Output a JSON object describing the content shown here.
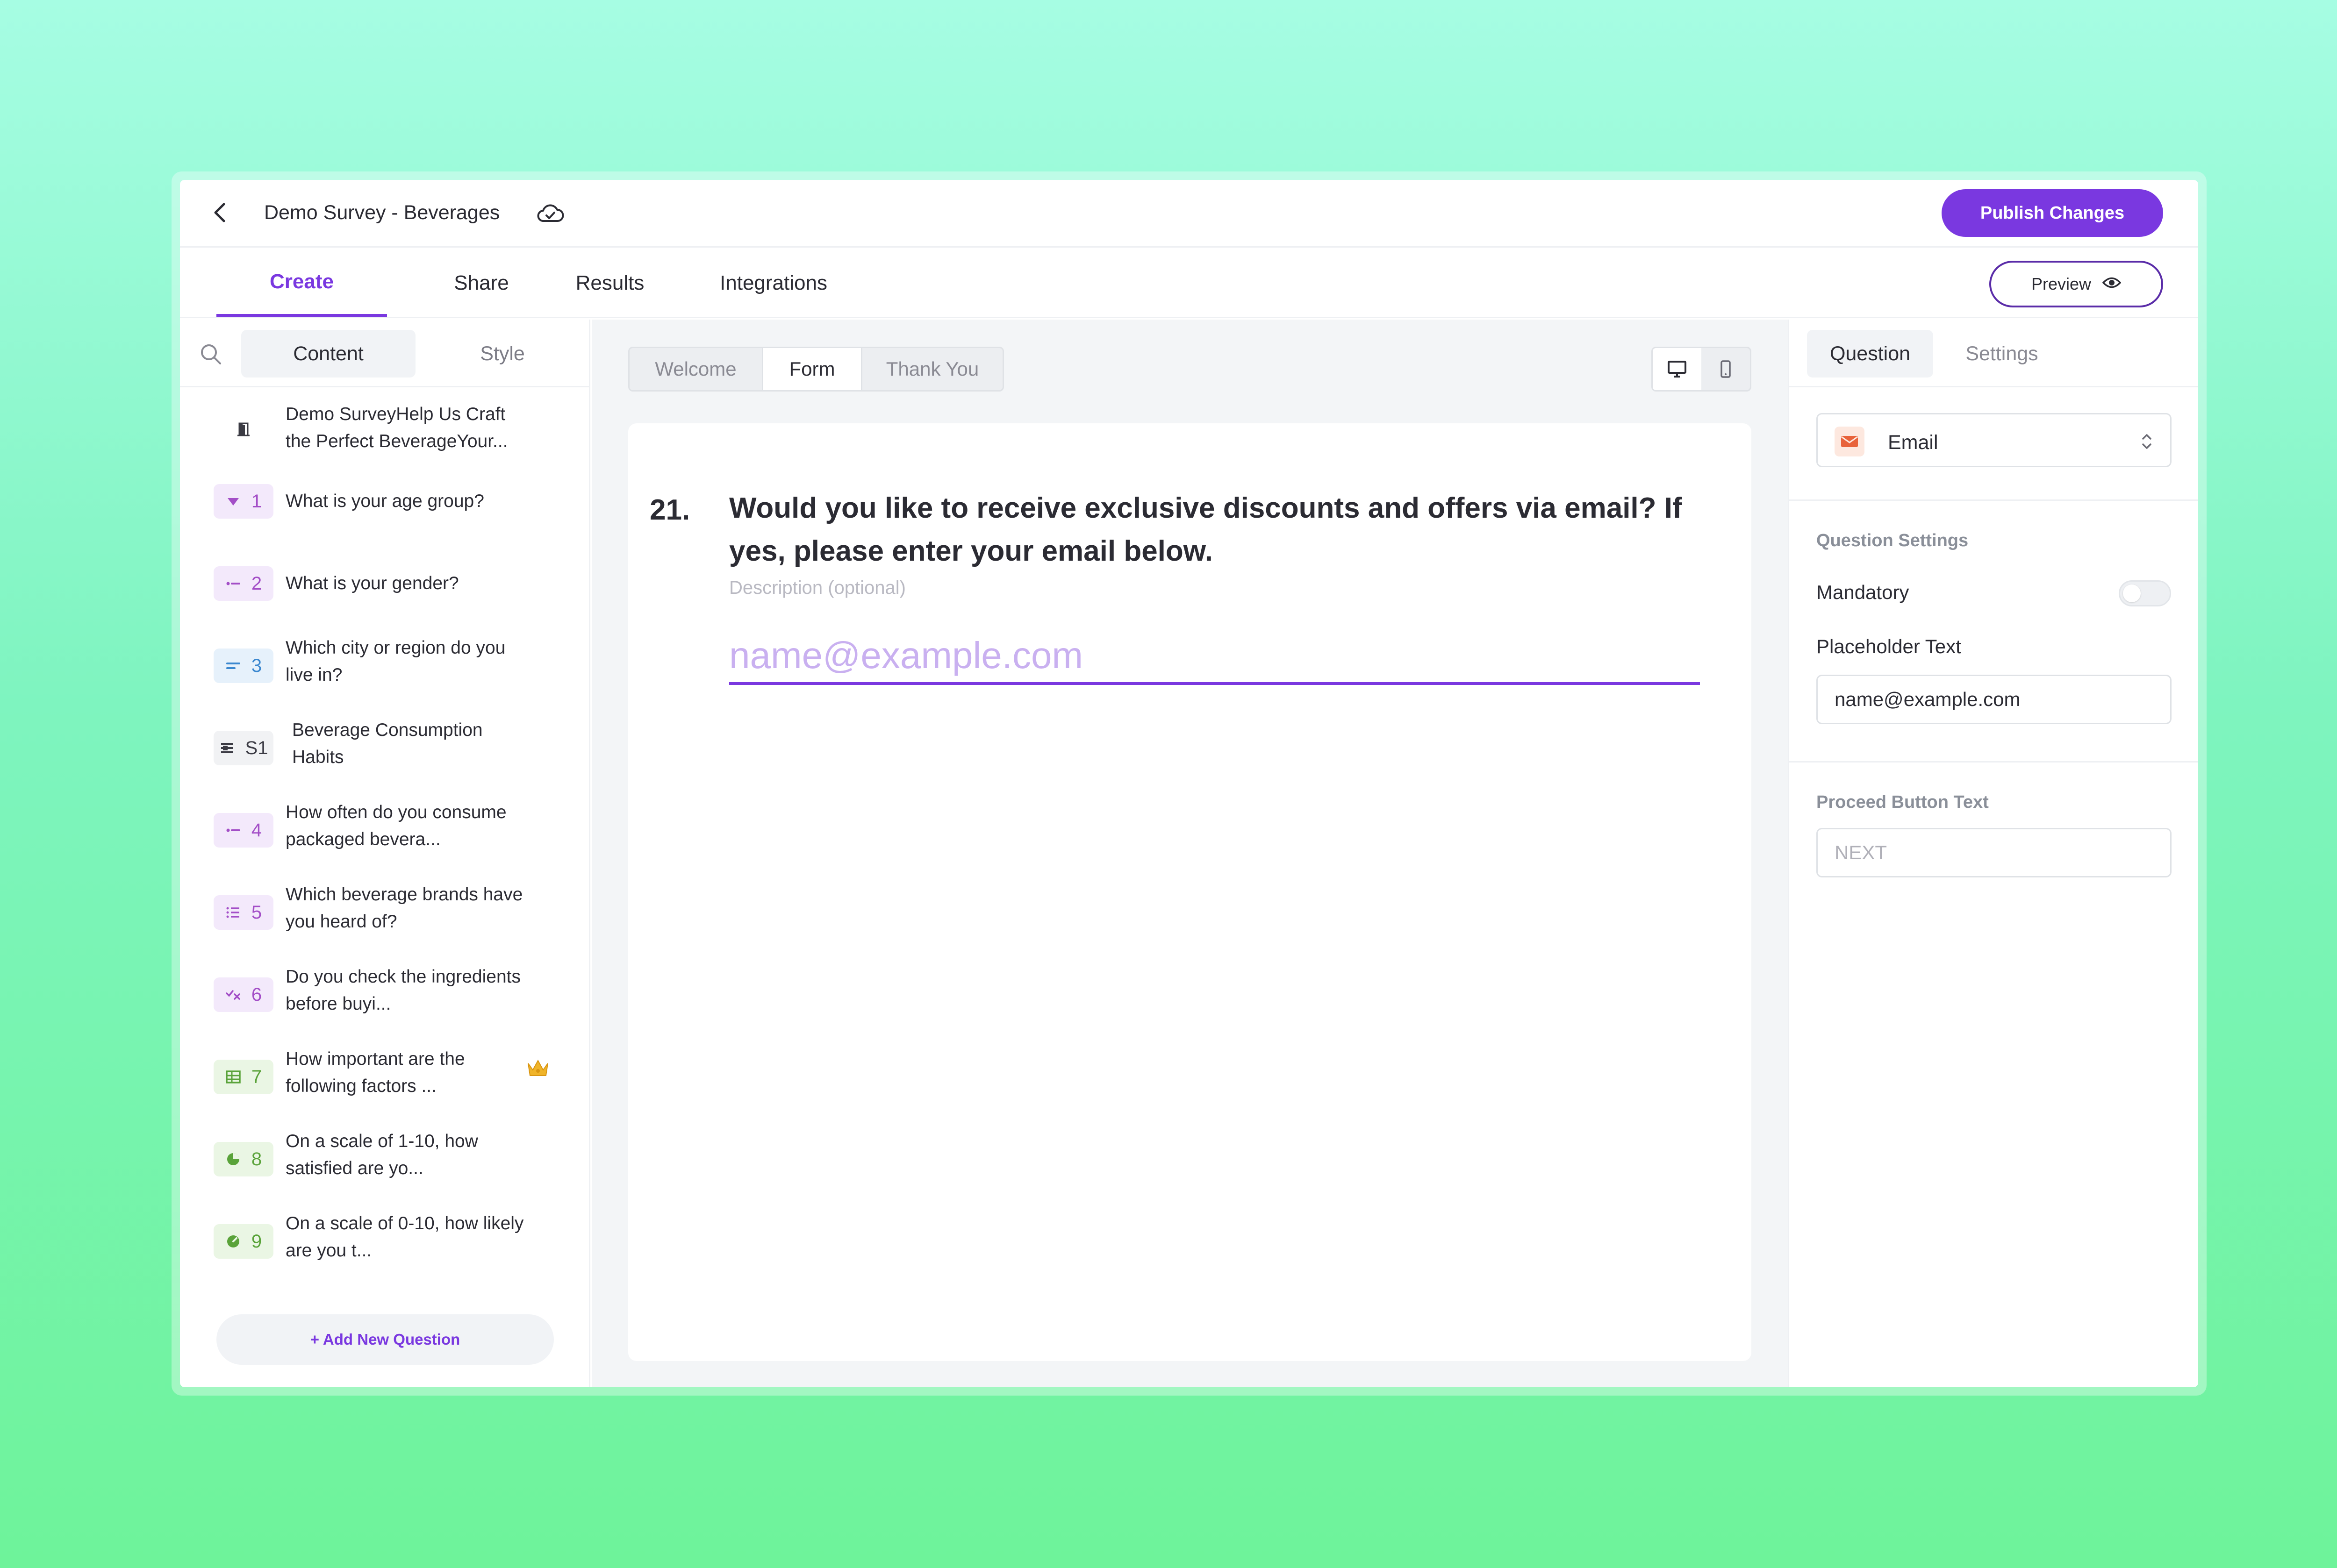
{
  "header": {
    "title": "Demo Survey - Beverages",
    "publish_label": "Publish Changes"
  },
  "tabs": {
    "create": "Create",
    "share": "Share",
    "results": "Results",
    "integrations": "Integrations",
    "preview": "Preview"
  },
  "sidebar": {
    "content_tab": "Content",
    "style_tab": "Style",
    "add_question": "+ Add New Question",
    "items": [
      {
        "badge": "",
        "icon": "door-icon",
        "text": "Demo SurveyHelp Us Craft the Perfect BeverageYour..."
      },
      {
        "badge": "1",
        "icon": "dropdown-icon",
        "text": "What is your age group?"
      },
      {
        "badge": "2",
        "icon": "choice-icon",
        "text": "What is your gender?"
      },
      {
        "badge": "3",
        "icon": "short-text-icon",
        "text": "Which city or region do you live in?"
      },
      {
        "badge": "S1",
        "icon": "section-icon",
        "text": "Beverage Consumption Habits"
      },
      {
        "badge": "4",
        "icon": "choice-icon",
        "text": "How often do you consume packaged bevera..."
      },
      {
        "badge": "5",
        "icon": "list-icon",
        "text": "Which beverage brands have you heard of?"
      },
      {
        "badge": "6",
        "icon": "yes-no-icon",
        "text": "Do you check the ingredients before buyi..."
      },
      {
        "badge": "7",
        "icon": "matrix-icon",
        "text": "How important are the following factors ..."
      },
      {
        "badge": "8",
        "icon": "rating-icon",
        "text": "On a scale of 1-10, how satisfied are yo..."
      },
      {
        "badge": "9",
        "icon": "nps-icon",
        "text": "On a scale of 0-10, how likely are you t..."
      }
    ]
  },
  "center": {
    "seg_welcome": "Welcome",
    "seg_form": "Form",
    "seg_thankyou": "Thank You",
    "question_number": "21.",
    "question_title": "Would you like to receive exclusive discounts and offers via email? If yes, please enter your email below.",
    "description_placeholder": "Description (optional)",
    "email_placeholder": "name@example.com"
  },
  "right_panel": {
    "question_tab": "Question",
    "settings_tab": "Settings",
    "type_label": "Email",
    "question_settings_label": "Question Settings",
    "mandatory_label": "Mandatory",
    "placeholder_text_label": "Placeholder Text",
    "placeholder_text_value": "name@example.com",
    "proceed_button_label": "Proceed Button Text",
    "proceed_button_placeholder": "NEXT"
  },
  "colors": {
    "accent": "#7a38e0",
    "purple_badge_bg": "#f3e9fb",
    "blue_badge_bg": "#e6f1fb",
    "green_badge_bg": "#eaf6e4",
    "gray_badge_bg": "#f1f2f4",
    "email_icon": "#e8623a"
  }
}
